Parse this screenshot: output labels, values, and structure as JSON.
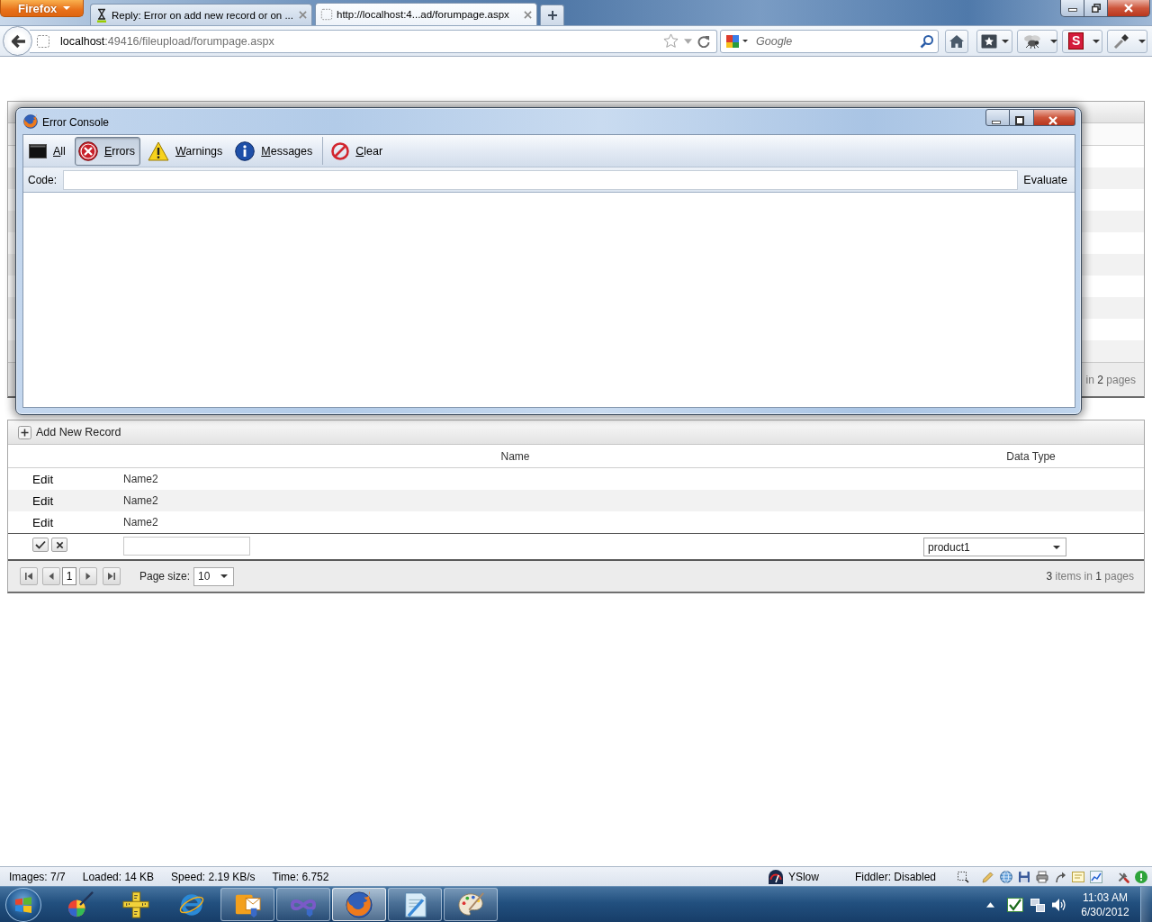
{
  "browser": {
    "menu_button": "Firefox",
    "tabs": [
      {
        "title": "Reply: Error on add new record or on ...",
        "selected": false
      },
      {
        "title": "http://localhost:4...ad/forumpage.aspx",
        "selected": true
      }
    ],
    "address": "**localhost**:49416/fileupload/forumpage.aspx",
    "search": {
      "placeholder": "Google"
    },
    "addon_letter": "S"
  },
  "background_grid": {
    "pager_summary": "in **2** pages"
  },
  "error_console": {
    "title": "Error Console",
    "filters": [
      {
        "label": "All",
        "kind": "all",
        "selected": false
      },
      {
        "label": "Errors",
        "kind": "errors",
        "selected": true
      },
      {
        "label": "Warnings",
        "kind": "warnings",
        "selected": false
      },
      {
        "label": "Messages",
        "kind": "messages",
        "selected": false
      }
    ],
    "clear_button": "Clear",
    "code_label": "Code:",
    "evaluate_button": "Evaluate"
  },
  "grid": {
    "add_button": "Add New Record",
    "columns": [
      "Name",
      "Data Type"
    ],
    "rows": [
      {
        "command": "Edit",
        "name": "Name2"
      },
      {
        "command": "Edit",
        "name": "Name2"
      },
      {
        "command": "Edit",
        "name": "Name2"
      }
    ],
    "insert_row": {
      "data_type": "product1"
    },
    "pager": {
      "pages": [
        {
          "label": "1",
          "selected": true
        }
      ],
      "page_size_label": "Page size:",
      "page_size": "10",
      "summary": "**3** items in **1** pages"
    }
  },
  "status_bar": {
    "items": [
      "Images: 7/7",
      "Loaded: 14 KB",
      "Speed: 2.19 KB/s",
      "Time: 6.752"
    ],
    "yslow": "YSlow",
    "fiddler": "Fiddler: Disabled"
  },
  "taskbar": {
    "apps": [
      {
        "kind": "disc",
        "running": false,
        "selected": false
      },
      {
        "kind": "ruler",
        "running": false,
        "selected": false
      },
      {
        "kind": "globe",
        "running": false,
        "selected": false
      },
      {
        "kind": "mail",
        "running": true,
        "selected": false
      },
      {
        "kind": "studio",
        "running": true,
        "selected": false
      },
      {
        "kind": "firefox",
        "running": true,
        "selected": true
      },
      {
        "kind": "notepad",
        "running": true,
        "selected": false
      },
      {
        "kind": "palette",
        "running": true,
        "selected": false
      }
    ],
    "clock": {
      "time": "11:03 AM",
      "date": "6/30/2012"
    }
  }
}
